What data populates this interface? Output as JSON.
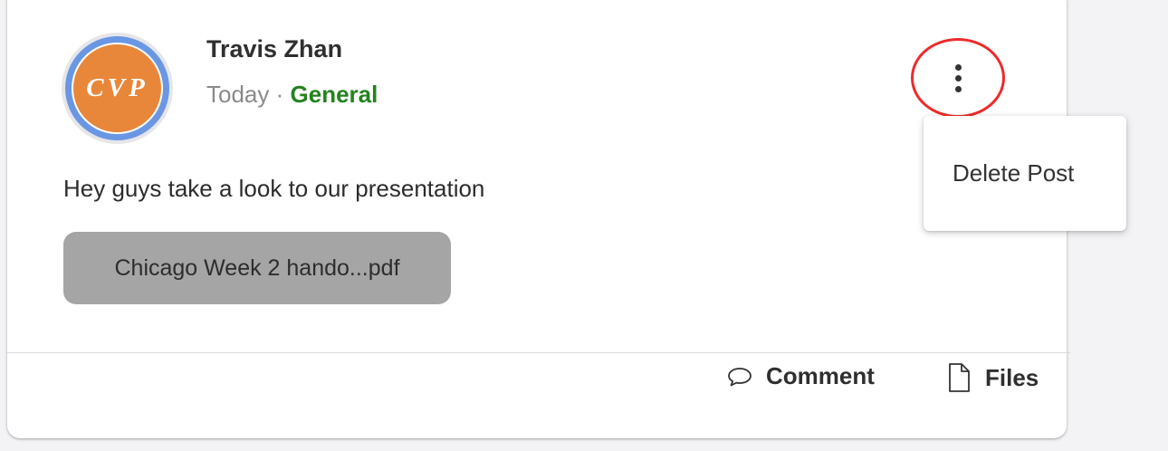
{
  "post": {
    "author": "Travis Zhan",
    "time": "Today",
    "separator": "·",
    "channel": "General",
    "avatar_text": "CVP",
    "body": "Hey guys take a look to our presentation",
    "attachment": "Chicago Week 2 hando...pdf"
  },
  "menu": {
    "delete_label": "Delete Post"
  },
  "actions": {
    "comment_label": "Comment",
    "files_label": "Files"
  },
  "colors": {
    "channel": "#25821f",
    "avatar_ring": "#6a97e3",
    "avatar_fill": "#e8873a",
    "highlight": "#ee2b2b",
    "attachment_bg": "#a5a5a5"
  },
  "icons": {
    "more": "more-vertical-icon",
    "comment": "speech-bubble-icon",
    "files": "document-icon"
  }
}
